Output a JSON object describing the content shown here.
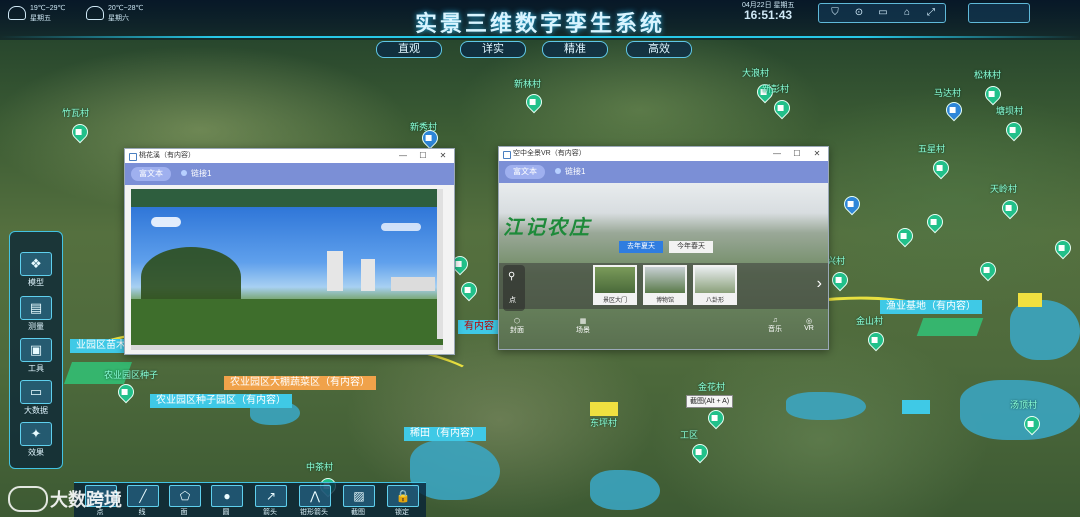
{
  "header": {
    "title": "实景三维数字孪生系统",
    "weather": [
      {
        "temp": "19℃~29℃",
        "day": "星期五"
      },
      {
        "temp": "20℃~28℃",
        "day": "星期六"
      }
    ],
    "date": "04月22日 星期五",
    "time": "16:51:43",
    "nav_tabs": [
      "直观",
      "详实",
      "精准",
      "高效"
    ],
    "toolbar_icons": [
      "shield-icon",
      "search-icon",
      "folder-icon",
      "home-icon",
      "expand-icon"
    ]
  },
  "map": {
    "places": [
      "新林村",
      "大浪村",
      "新彭村",
      "松林村",
      "竹瓦村",
      "马达村",
      "塘坝村",
      "五星村",
      "天岭村",
      "新兴村",
      "金山村",
      "农业园区种子",
      "金花村",
      "中茶村",
      "汤顶村",
      "东坪村",
      "新秀村",
      "工区"
    ],
    "tags": [
      {
        "text": "农业园区大棚蔬菜区（有内容）"
      },
      {
        "text": "农业园区种子园区（有内容）"
      },
      {
        "text": "稀田（有内容）"
      },
      {
        "text": "渔业基地（有内容）"
      },
      {
        "text": "业园区苗木"
      },
      {
        "text": "有内容"
      }
    ]
  },
  "window1": {
    "title": "桃花溪（有内容）",
    "tabs": [
      "富文本",
      "链接1"
    ]
  },
  "window2": {
    "title": "空中全景VR（有内容）",
    "tabs": [
      "富文本",
      "链接1"
    ],
    "banner_text": "江记农庄",
    "season_tabs": [
      "去年夏天",
      "今年春天"
    ],
    "thumbnails": [
      "景区大门",
      "博物馆",
      "八卦形"
    ],
    "side_label": "点",
    "bottom_icons": [
      {
        "label": "封面",
        "icon": "cover-icon"
      },
      {
        "label": "场景",
        "icon": "grid-icon"
      },
      {
        "label": "音乐",
        "icon": "music-icon"
      },
      {
        "label": "VR",
        "icon": "vr-icon"
      }
    ],
    "tooltip": "截图(Alt + A)"
  },
  "left_tools": [
    {
      "label": "模型",
      "icon": "cubes-icon"
    },
    {
      "label": "测量",
      "icon": "ruler-icon"
    },
    {
      "label": "工具",
      "icon": "toolbox-icon"
    },
    {
      "label": "大数据",
      "icon": "monitor-icon"
    },
    {
      "label": "效果",
      "icon": "sparkle-icon"
    }
  ],
  "bottom_tools": [
    {
      "label": "点",
      "icon": "point-icon"
    },
    {
      "label": "线",
      "icon": "line-icon"
    },
    {
      "label": "面",
      "icon": "polygon-icon"
    },
    {
      "label": "圆",
      "icon": "circle-icon"
    },
    {
      "label": "箭头",
      "icon": "arrow-icon"
    },
    {
      "label": "钳形箭头",
      "icon": "pincer-arrow-icon"
    },
    {
      "label": "截图",
      "icon": "image-icon"
    },
    {
      "label": "锁定",
      "icon": "lock-icon"
    }
  ],
  "watermark": "大数跨境",
  "colors": {
    "accent": "#28c8e8",
    "window_tab_bar": "#7b8fd6",
    "tag_orange": "#f0a24a",
    "tag_cyan": "#3fc9e6",
    "road": "#e8e040"
  }
}
